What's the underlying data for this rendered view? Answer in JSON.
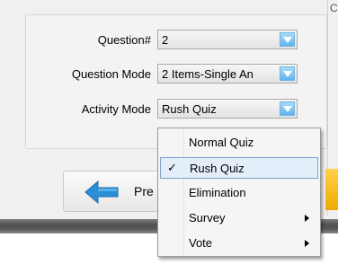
{
  "form": {
    "question_number": {
      "label": "Question#",
      "value": "2"
    },
    "question_mode": {
      "label": "Question Mode",
      "value": "2 Items-Single An"
    },
    "activity_mode": {
      "label": "Activity Mode",
      "value": "Rush Quiz"
    }
  },
  "prev_button": {
    "label": "Pre"
  },
  "right_panel_glyph": "C",
  "dropdown": {
    "items": [
      {
        "label": "Normal Quiz",
        "checked": false,
        "submenu": false
      },
      {
        "label": "Rush Quiz",
        "checked": true,
        "submenu": false
      },
      {
        "label": "Elimination",
        "checked": false,
        "submenu": false
      },
      {
        "label": "Survey",
        "checked": false,
        "submenu": true
      },
      {
        "label": "Vote",
        "checked": false,
        "submenu": true
      }
    ],
    "check_mark": "✓"
  },
  "colors": {
    "accent_blue": "#5fb4ec",
    "selection_bg": "#e3eefa",
    "selection_border": "#7da2ce",
    "prev_arrow": "#2a8fd6",
    "yellow_button": "#f2a900"
  }
}
